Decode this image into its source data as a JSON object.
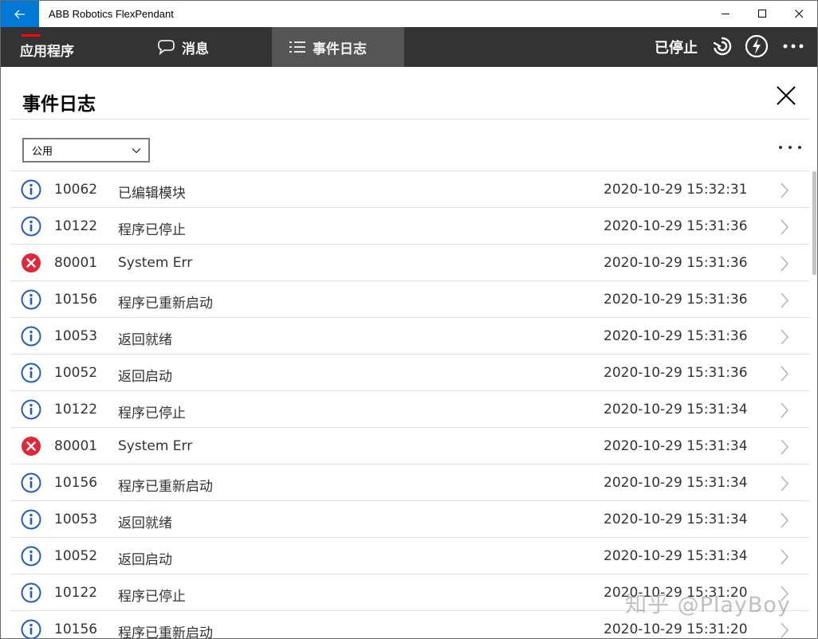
{
  "window": {
    "title": "ABB Robotics FlexPendant"
  },
  "appbar": {
    "tabs": [
      {
        "label": "应用程序"
      },
      {
        "label": "消息"
      },
      {
        "label": "事件日志"
      }
    ],
    "status": "已停止",
    "colors": {
      "header_bg": "#333333",
      "active_tab_bg": "#555555",
      "accent_red": "#ff000f",
      "titlebar_blue": "#0078d7"
    }
  },
  "page": {
    "title": "事件日志",
    "filter_selected": "公用"
  },
  "events": [
    {
      "type": "info",
      "code": "10062",
      "title": "已编辑模块",
      "time": "2020-10-29 15:32:31"
    },
    {
      "type": "info",
      "code": "10122",
      "title": "程序已停止",
      "time": "2020-10-29 15:31:36"
    },
    {
      "type": "error",
      "code": "80001",
      "title": "System Err",
      "time": "2020-10-29 15:31:36"
    },
    {
      "type": "info",
      "code": "10156",
      "title": "程序已重新启动",
      "time": "2020-10-29 15:31:36"
    },
    {
      "type": "info",
      "code": "10053",
      "title": "返回就绪",
      "time": "2020-10-29 15:31:36"
    },
    {
      "type": "info",
      "code": "10052",
      "title": "返回启动",
      "time": "2020-10-29 15:31:36"
    },
    {
      "type": "info",
      "code": "10122",
      "title": "程序已停止",
      "time": "2020-10-29 15:31:34"
    },
    {
      "type": "error",
      "code": "80001",
      "title": "System Err",
      "time": "2020-10-29 15:31:34"
    },
    {
      "type": "info",
      "code": "10156",
      "title": "程序已重新启动",
      "time": "2020-10-29 15:31:34"
    },
    {
      "type": "info",
      "code": "10053",
      "title": "返回就绪",
      "time": "2020-10-29 15:31:34"
    },
    {
      "type": "info",
      "code": "10052",
      "title": "返回启动",
      "time": "2020-10-29 15:31:34"
    },
    {
      "type": "info",
      "code": "10122",
      "title": "程序已停止",
      "time": "2020-10-29 15:31:20"
    },
    {
      "type": "info",
      "code": "10156",
      "title": "程序已重新启动",
      "time": "2020-10-29 15:31:20"
    }
  ],
  "icons": {
    "info": "info-circle-icon",
    "error": "error-x-circle-icon",
    "info_color": "#1f5fb8",
    "error_color": "#e0283c"
  },
  "watermark": "知乎 @PlayBoy"
}
